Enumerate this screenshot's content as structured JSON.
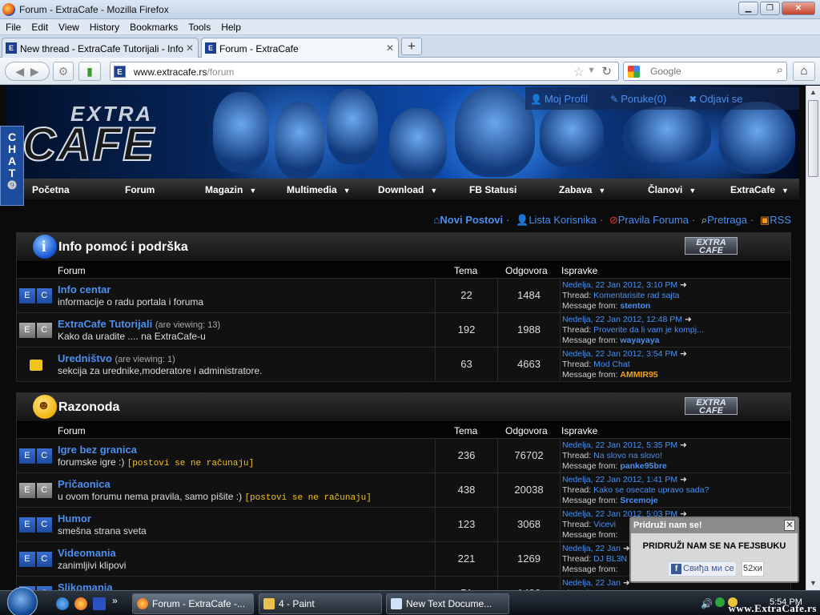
{
  "window": {
    "title": "Forum - ExtraCafe - Mozilla Firefox"
  },
  "menu": [
    "File",
    "Edit",
    "View",
    "History",
    "Bookmarks",
    "Tools",
    "Help"
  ],
  "tabs": [
    {
      "label": "New thread - ExtraCafe Tutorijali - Info p...",
      "active": false
    },
    {
      "label": "Forum - ExtraCafe",
      "active": true
    }
  ],
  "nav": {
    "url_host": "www.extracafe.rs",
    "url_path": "/forum",
    "search_placeholder": "Google"
  },
  "site": {
    "logo_top": "EXTRA",
    "logo_main": "CAFE",
    "user_menu": [
      "Moj Profil",
      "Poruke(0)",
      "Odjavi se"
    ],
    "chat_tab": "CHAT",
    "main_nav": [
      {
        "label": "Početna",
        "dropdown": false
      },
      {
        "label": "Forum",
        "dropdown": false
      },
      {
        "label": "Magazin",
        "dropdown": true
      },
      {
        "label": "Multimedia",
        "dropdown": true
      },
      {
        "label": "Download",
        "dropdown": true
      },
      {
        "label": "FB Statusi",
        "dropdown": false
      },
      {
        "label": "Zabava",
        "dropdown": true
      },
      {
        "label": "Članovi",
        "dropdown": true
      },
      {
        "label": "ExtraCafe",
        "dropdown": true
      }
    ],
    "quick_links": [
      "Novi Postovi",
      "Lista Korisnika",
      "Pravila Foruma",
      "Pretraga",
      "RSS"
    ]
  },
  "columns": {
    "forum": "Forum",
    "topics": "Tema",
    "posts": "Odgovora",
    "last": "Ispravke"
  },
  "categories": [
    {
      "title": "Info pomoć i podrška",
      "icon": "info-icon",
      "logo": "EXTRA CAFE",
      "forums": [
        {
          "name": "Info centar",
          "viewing": "",
          "desc": "informacije o radu portala i foruma",
          "note": "",
          "icon": "blue",
          "topics": "22",
          "posts": "1484",
          "date": "Nedelja, 22 Jan 2012, 3:10 PM",
          "thread": "Komentarisite rad sajta",
          "user": "stenton",
          "user_color": "blue"
        },
        {
          "name": "ExtraCafe Tutorijali",
          "viewing": "(are viewing: 13)",
          "desc": "Kako da uradite .... na ExtraCafe-u",
          "note": "",
          "icon": "grey",
          "topics": "192",
          "posts": "1988",
          "date": "Nedelja, 22 Jan 2012, 12:48 PM",
          "thread": "Proverite da li vam je kompj...",
          "user": "wayayaya",
          "user_color": "blue"
        },
        {
          "name": "Uredništvo",
          "viewing": "(are viewing: 1)",
          "desc": "sekcija za urednike,moderatore i administratore.",
          "note": "",
          "icon": "lock",
          "topics": "63",
          "posts": "4663",
          "date": "Nedelja, 22 Jan 2012, 3:54 PM",
          "thread": "Mod Chat",
          "user": "AMMIR95",
          "user_color": "orange"
        }
      ]
    },
    {
      "title": "Razonoda",
      "icon": "smiley-icon",
      "logo": "EXTRA CAFE",
      "forums": [
        {
          "name": "Igre bez granica",
          "viewing": "",
          "desc": "forumske igre :) ",
          "note": "[postovi se ne računaju]",
          "icon": "blue",
          "topics": "236",
          "posts": "76702",
          "date": "Nedelja, 22 Jan 2012, 5:35 PM",
          "thread": "Na slovo na slovo!",
          "user": "panke95bre",
          "user_color": "blue"
        },
        {
          "name": "Pričaonica",
          "viewing": "",
          "desc": "u ovom forumu nema pravila, samo pišite :) ",
          "note": "[postovi se ne računaju]",
          "icon": "grey",
          "topics": "438",
          "posts": "20038",
          "date": "Nedelja, 22 Jan 2012, 1:41 PM",
          "thread": "Kako se osecate upravo sada?",
          "user": "Srcemoje",
          "user_color": "blue"
        },
        {
          "name": "Humor",
          "viewing": "",
          "desc": "smešna strana sveta",
          "note": "",
          "icon": "blue",
          "topics": "123",
          "posts": "3068",
          "date": "Nedelja, 22 Jan 2012, 5:03 PM",
          "thread": "Vicevi",
          "user": "",
          "user_color": "blue"
        },
        {
          "name": "Videomania",
          "viewing": "",
          "desc": "zanimljivi klipovi",
          "note": "",
          "icon": "blue",
          "topics": "221",
          "posts": "1269",
          "date": "Nedelja, 22 Jan",
          "thread": "DJ BL3N",
          "user": "",
          "user_color": "blue"
        },
        {
          "name": "Slikomania",
          "viewing": "",
          "desc": "",
          "note": "",
          "icon": "blue",
          "topics": "51",
          "posts": "1406",
          "date": "Nedelja, 22 Jan",
          "thread": "",
          "user": "",
          "user_color": "blue"
        }
      ]
    }
  ],
  "labels": {
    "thread": "Thread:",
    "message_from": "Message from:"
  },
  "fb_popup": {
    "header": "Pridruži nam se!",
    "text": "PRIDRUŽI NAM SE NA FEJSBUKU",
    "like": "Свиђа ми се",
    "count": "52хи"
  },
  "taskbar": {
    "buttons": [
      "Forum - ExtraCafe -...",
      "4 - Paint",
      "New Text Docume..."
    ],
    "clock": "5:54 PM",
    "watermark": "www.ExtraCafe.rs"
  }
}
